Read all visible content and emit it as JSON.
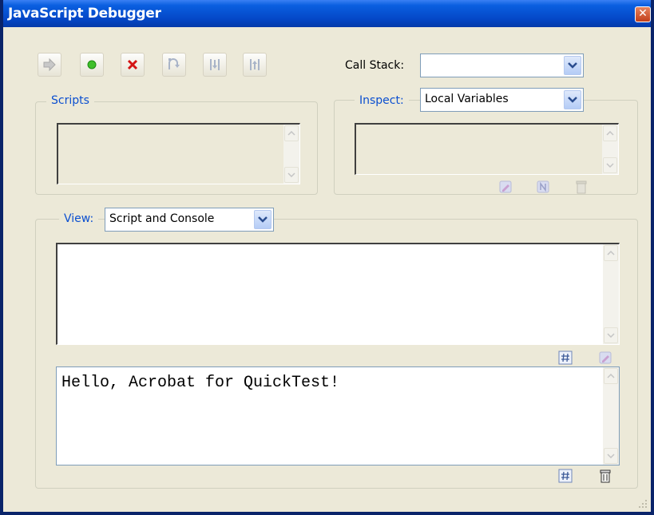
{
  "window": {
    "title": "JavaScript Debugger"
  },
  "toolbar": {
    "resume_icon": "resume-arrow-icon",
    "interrupt_icon": "green-dot-icon",
    "quit_icon": "red-x-icon",
    "step_over_icon": "step-over-icon",
    "step_into_icon": "step-into-icon",
    "step_out_icon": "step-out-icon"
  },
  "call_stack": {
    "label": "Call Stack:",
    "value": ""
  },
  "scripts": {
    "legend": "Scripts"
  },
  "inspect": {
    "label": "Inspect:",
    "value": "Local Variables"
  },
  "view": {
    "label": "View:",
    "value": "Script and Console"
  },
  "console": {
    "text": "Hello, Acrobat for QuickTest!"
  },
  "colors": {
    "title_bar": "#0447c7",
    "accent_label": "#0b4fd0",
    "window_bg": "#ece9d8"
  }
}
